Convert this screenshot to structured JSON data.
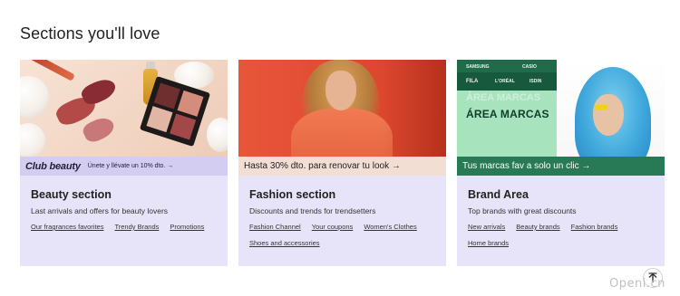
{
  "page": {
    "section_title": "Sections you'll love"
  },
  "cards": [
    {
      "banner_brand": "Club beauty",
      "banner_text": "Únete y llévate un 10% dto. →",
      "title": "Beauty section",
      "description": "Last arrivals and offers for beauty lovers",
      "links": [
        "Our fragrances favorites",
        "Trendy Brands",
        "Promotions"
      ]
    },
    {
      "banner_text": "Hasta 30% dto. para renovar tu look →",
      "title": "Fashion section",
      "description": "Discounts and trends for trendsetters",
      "links": [
        "Fashion Channel",
        "Your coupons",
        "Women's Clothes",
        "Shoes and accessories"
      ]
    },
    {
      "banner_heading": "ÁREA MARCAS",
      "banner_brands": [
        "SAMSUNG",
        "CASIO",
        "FILA",
        "L'ORÉAL",
        "ISDIN"
      ],
      "banner_text": "Tus marcas fav a solo un clic →",
      "title": "Brand Area",
      "description": "Top brands with great discounts",
      "links": [
        "New arrivals",
        "Beauty brands",
        "Fashion brands",
        "Home brands"
      ]
    }
  ],
  "scroll_top": {
    "icon": "arrow-up-icon"
  },
  "watermark": "Openi.cn",
  "colors": {
    "card_bg": "#e7e4f9",
    "beauty_strip": "#d3cdf2",
    "fashion_strip": "#f3ded4",
    "brand_strip": "#277a55"
  }
}
